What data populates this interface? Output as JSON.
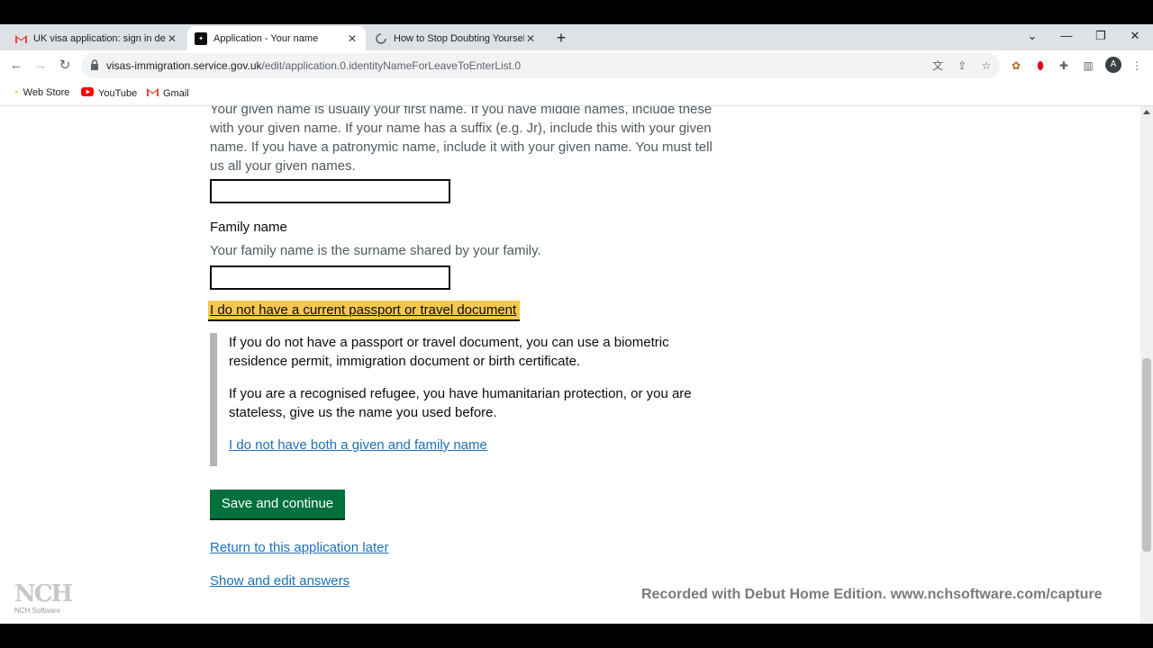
{
  "browser": {
    "tabs": [
      {
        "title": "UK visa application: sign in detail",
        "favicon": "gmail-icon",
        "active": false
      },
      {
        "title": "Application - Your name",
        "favicon": "gov-uk-icon",
        "active": true
      },
      {
        "title": "How to Stop Doubting Yourself |",
        "favicon": "loading-icon",
        "active": false
      }
    ],
    "url_domain": "visas-immigration.service.gov.uk",
    "url_path": "/edit/application.0.identityNameForLeaveToEnterList.0",
    "profile_initial": "A",
    "bookmarks": [
      {
        "label": "Web Store",
        "icon": "web-store-icon"
      },
      {
        "label": "YouTube",
        "icon": "youtube-icon"
      },
      {
        "label": "Gmail",
        "icon": "gmail-icon"
      }
    ]
  },
  "form": {
    "given_name_hint": "Your given name is usually your first name. If you have middle names, include these with your given name. If your name has a suffix (e.g. Jr), include this with your given name. If you have a patronymic name, include it with your given name. You must tell us all your given names.",
    "given_name_value": "",
    "family_name_label": "Family name",
    "family_name_hint": "Your family name is the surname shared by your family.",
    "family_name_value": "",
    "details_summary": "I do not have a current passport or travel document",
    "details_para1": "If you do not have a passport or travel document, you can use a biometric residence permit, immigration document or birth certificate.",
    "details_para2": "If you are a recognised refugee, you have humanitarian protection, or you are stateless, give us the name you used before.",
    "details_link": "I do not have both a given and family name",
    "save_button": "Save and continue",
    "return_link": "Return to this application later",
    "show_answers_link": "Show and edit answers"
  },
  "overlay": {
    "watermark": "Recorded with Debut Home Edition. www.nchsoftware.com/capture",
    "logo_text": "NCH",
    "logo_sub": "NCH Software"
  }
}
